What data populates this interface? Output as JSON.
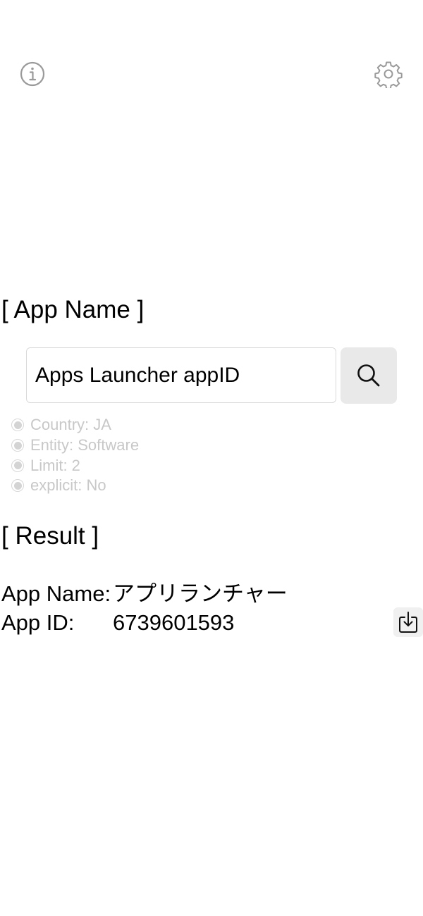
{
  "header": {
    "info_icon": "info-circle-icon",
    "settings_icon": "gear-icon"
  },
  "search_section": {
    "title": "[ App Name ]",
    "query_value": "Apps Launcher appID",
    "search_icon": "magnifier-icon",
    "options": [
      {
        "label": "Country: JA"
      },
      {
        "label": "Entity: Software"
      },
      {
        "label": "Limit: 2"
      },
      {
        "label": "explicit: No"
      }
    ]
  },
  "result_section": {
    "title": "[ Result ]",
    "app_name_label": "App Name:",
    "app_name_value": "アプリランチャー",
    "app_id_label": "App ID:",
    "app_id_value": "6739601593",
    "save_icon": "download-tray-icon"
  },
  "colors": {
    "text": "#000000",
    "icon_gray": "#9a9a9a",
    "option_text": "#c8c8c8",
    "button_bg": "#e9e9e9",
    "field_border": "#d9d9d9"
  }
}
